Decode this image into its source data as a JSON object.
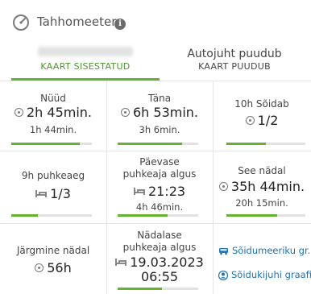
{
  "header": {
    "title": "Tahhomeeter",
    "info_icon": "info-icon"
  },
  "tabs": [
    {
      "name": "",
      "sub": "KAART SISESTATUD",
      "active": true
    },
    {
      "name": "Autojuht puudub",
      "sub": "KAART PUUDUB",
      "active": false
    }
  ],
  "cells": {
    "now": {
      "label": "Nüüd",
      "value": "2h 45min.",
      "sub": "1h 44min.",
      "progress": 0.85
    },
    "today": {
      "label": "Täna",
      "value": "6h 53min.",
      "sub": "3h 6min.",
      "progress": 0.8
    },
    "driving10h": {
      "label": "10h Sõidab",
      "value": "1/2",
      "progress": 0.5
    },
    "rest9h": {
      "label": "9h puhkeaeg",
      "value": "1/3",
      "progress": 0.33
    },
    "daily_rest": {
      "label": "Päevase puhkeaja algus",
      "value": "21:23",
      "sub": "4h 46min.",
      "progress": 0.62
    },
    "this_week": {
      "label": "See nädal",
      "value": "35h 44min.",
      "sub": "20h 15min.",
      "progress": 0.64
    },
    "next_week": {
      "label": "Järgmine nädal",
      "value": "56h"
    },
    "weekly_rest": {
      "label": "Nädalase puhkeaja algus",
      "value": "19.03.2023 06:55",
      "progress": 0.55
    }
  },
  "links": {
    "driving_records": "Sõidumeeriku gr...",
    "driver_graph": "Sõidukijuhi graafi"
  },
  "colors": {
    "accent": "#63b32e",
    "link": "#1a73b8"
  }
}
